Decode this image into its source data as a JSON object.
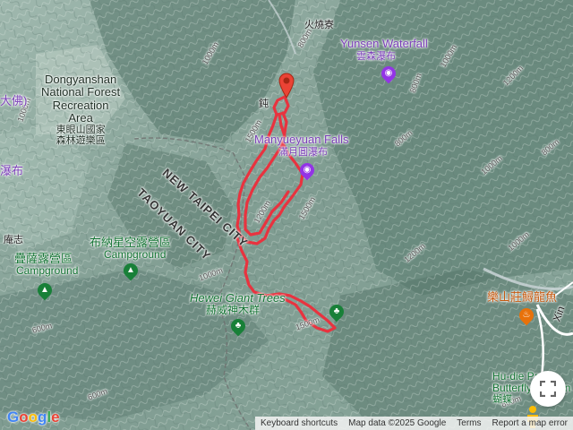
{
  "labels": {
    "huoshaoliao": "火燒寮",
    "yunsen_en": "Yunsen Waterfall",
    "yunsen_zh": "雲森瀑布",
    "dongyanshan_en_1": "Dongyanshan",
    "dongyanshan_en_2": "National Forest",
    "dongyanshan_en_3": "Recreation",
    "dongyanshan_en_4": "Area",
    "dongyanshan_zh_1": "東眼山國家",
    "dongyanshan_zh_2": "森林遊樂區",
    "left_fall_partial": "瀑布",
    "left_dafo_partial": "大佛)",
    "manyueyuan_en": "Manyueyuan Falls",
    "manyueyuan_zh": "滿月圓瀑布",
    "newtaipei": "NEW TAIPEI CITY",
    "taoyuan": "TAOYUAN CITY",
    "anzhi": "庵志",
    "sarah_zh": "疊薩露營區",
    "sarah_en": "Campground",
    "bunah_zh": "布納星空露營區",
    "bunah_en": "Campground",
    "hewei_en": "Hewei Giant Trees",
    "hewei_zh": "赫威神木群",
    "lushan_zh": "樂山莊鱘龍魚",
    "hudie_en_1": "Hu-die Park/",
    "hudie_en_2": "Butterfly Garden",
    "hudie_zh": "蝴蝶",
    "xin_partial": "Xin",
    "trail_start_char": "鈍"
  },
  "elevations": [
    "1000m",
    "1000m",
    "1500m",
    "800m",
    "1200m",
    "1000m",
    "1000m",
    "1500m",
    "800m",
    "1000m",
    "1200m",
    "600m",
    "1000m",
    "1500m",
    "1200m",
    "600m",
    "800m",
    "800m",
    "800m"
  ],
  "attribution": {
    "keyboard": "Keyboard shortcuts",
    "mapdata": "Map data ©2025 Google",
    "terms": "Terms",
    "report": "Report a map error"
  },
  "logo": "Google",
  "colors": {
    "route": "#e8333f",
    "poi_purple": "#9334e6",
    "poi_green": "#188038",
    "poi_orange": "#e8710a"
  },
  "icons": {
    "pin": "red-location-pin",
    "waterfall": "camera-icon",
    "campground": "tent-icon",
    "park": "tree-icon",
    "restaurant": "fork-knife-icon",
    "fullscreen": "fullscreen-icon",
    "pegman": "pegman-icon"
  }
}
